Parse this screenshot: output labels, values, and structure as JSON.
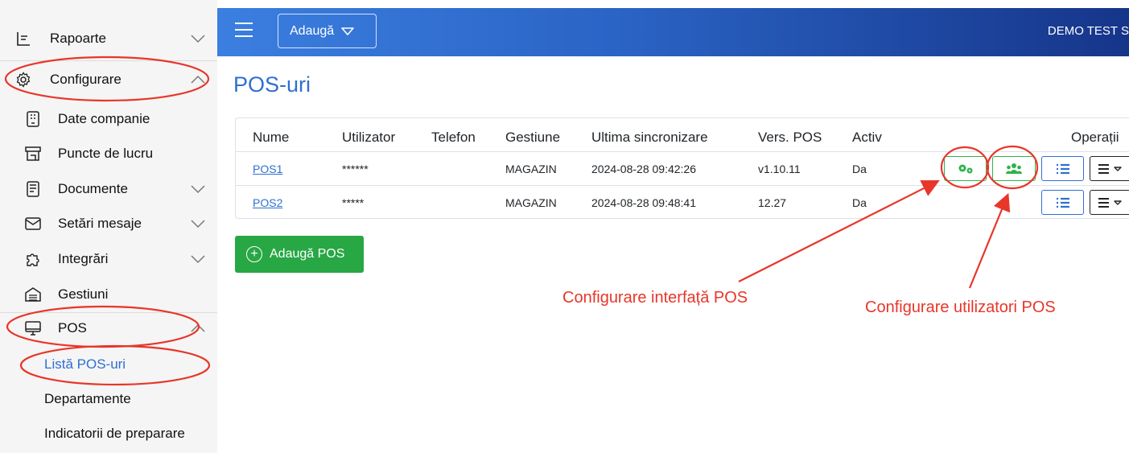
{
  "sidebar": {
    "items": [
      {
        "label": "Rapoarte",
        "icon": "report-icon"
      },
      {
        "label": "Configurare",
        "icon": "gear-icon"
      },
      {
        "label": "Date companie",
        "icon": "building-icon"
      },
      {
        "label": "Puncte de lucru",
        "icon": "store-icon"
      },
      {
        "label": "Documente",
        "icon": "document-icon"
      },
      {
        "label": "Setări mesaje",
        "icon": "envelope-icon"
      },
      {
        "label": "Integrări",
        "icon": "puzzle-icon"
      },
      {
        "label": "Gestiuni",
        "icon": "warehouse-icon"
      },
      {
        "label": "POS",
        "icon": "monitor-icon"
      },
      {
        "label": "Listă POS-uri"
      },
      {
        "label": "Departamente"
      },
      {
        "label": "Indicatorii de preparare"
      }
    ]
  },
  "topbar": {
    "menu_icon": "hamburger-icon",
    "add_label": "Adaugă",
    "company": "DEMO TEST S"
  },
  "main": {
    "title": "POS-uri",
    "columns": [
      "Nume",
      "Utilizator",
      "Telefon",
      "Gestiune",
      "Ultima sincronizare",
      "Vers. POS",
      "Activ",
      "Operații"
    ],
    "rows": [
      {
        "name": "POS1",
        "user": "******",
        "phone": "",
        "gestiune": "MAGAZIN",
        "sync": "2024-08-28 09:42:26",
        "version": "v1.10.11",
        "active": "Da"
      },
      {
        "name": "POS2",
        "user": "*****",
        "phone": "",
        "gestiune": "MAGAZIN",
        "sync": "2024-08-28 09:48:41",
        "version": "12.27",
        "active": "Da"
      }
    ],
    "add_pos_label": "Adaugă POS"
  },
  "annotations": {
    "interface": "Configurare interfață POS",
    "users": "Configurare utilizatori POS"
  },
  "colors": {
    "accent": "#2f6fd0",
    "success": "#28a745",
    "annotation": "#e8362a"
  }
}
